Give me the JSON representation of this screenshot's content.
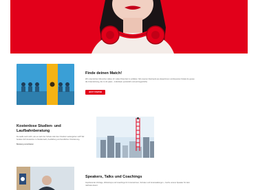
{
  "sections": [
    {
      "title": "Finde deinen Match!",
      "body": "Wir unterstützen Menschen dabei, ihr volles Potenzial zu entfalten. Mit unserem Netzwerk aus Expertinnen und Experten findest du genau die Unterstützung, die zu dir passt – individuell, persönlich und auf Augenhöhe.",
      "button": "JETZT STARTEN"
    },
    {
      "title": "Kostenlose Studien- und Laufbahnberatung",
      "body": "Du weißt noch nicht, wie es nach der Schule oder dem Studium weitergehen soll? Wir beraten dich kostenlos zu Studienwahl, Ausbildung und beruflicher Orientierung.",
      "link": "Beratung vereinbaren"
    },
    {
      "title": "Speakers, Talks und Coachings",
      "body": "Inspirierende Vorträge, Workshops und Coachings für Unternehmen, Schulen und Veranstaltungen – buche unsere Speaker für dein nächstes Event."
    }
  ]
}
